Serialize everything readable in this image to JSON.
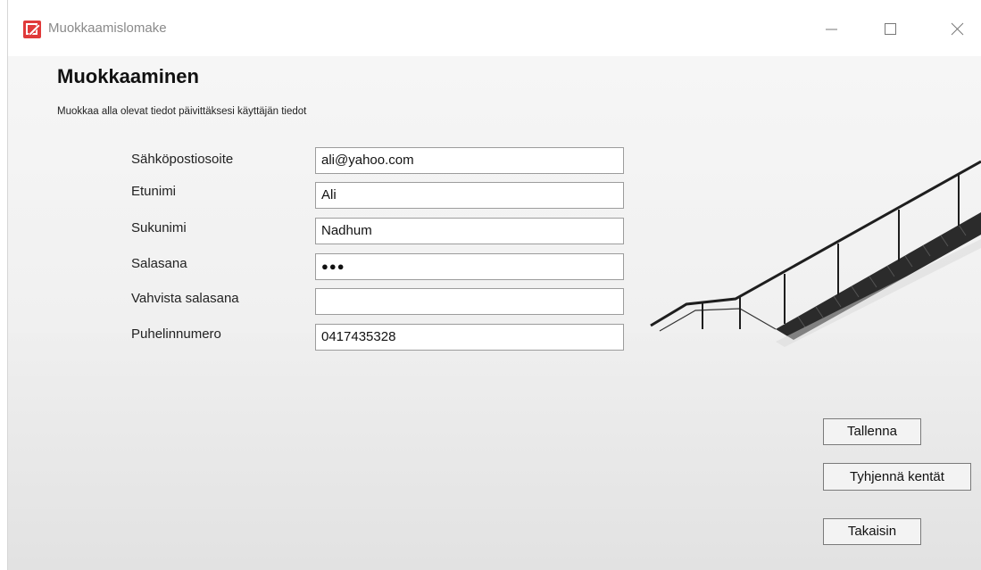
{
  "window": {
    "title": "Muokkaamislomake",
    "minimize_glyph": "—",
    "maximize_glyph": "☐",
    "close_glyph": "✕"
  },
  "form": {
    "heading": "Muokkaaminen",
    "subtitle": "Muokkaa alla olevat tiedot päivittäksesi käyttäjän tiedot",
    "fields": [
      {
        "label": "Sähköpostiosoite",
        "value": "ali@yahoo.com"
      },
      {
        "label": "Etunimi",
        "value": "Ali"
      },
      {
        "label": "Sukunimi",
        "value": "Nadhum"
      },
      {
        "label": "Salasana",
        "value": "●●●"
      },
      {
        "label": "Vahvista salasana",
        "value": ""
      },
      {
        "label": "Puhelinnumero",
        "value": "0417435328"
      }
    ]
  },
  "buttons": {
    "save": "Tallenna",
    "clear": "Tyhjennä kentät",
    "back": "Takaisin"
  },
  "colors": {
    "app_icon": "#e03a3a",
    "background": "#f1f1f1",
    "stair": "#2a2a2a"
  }
}
